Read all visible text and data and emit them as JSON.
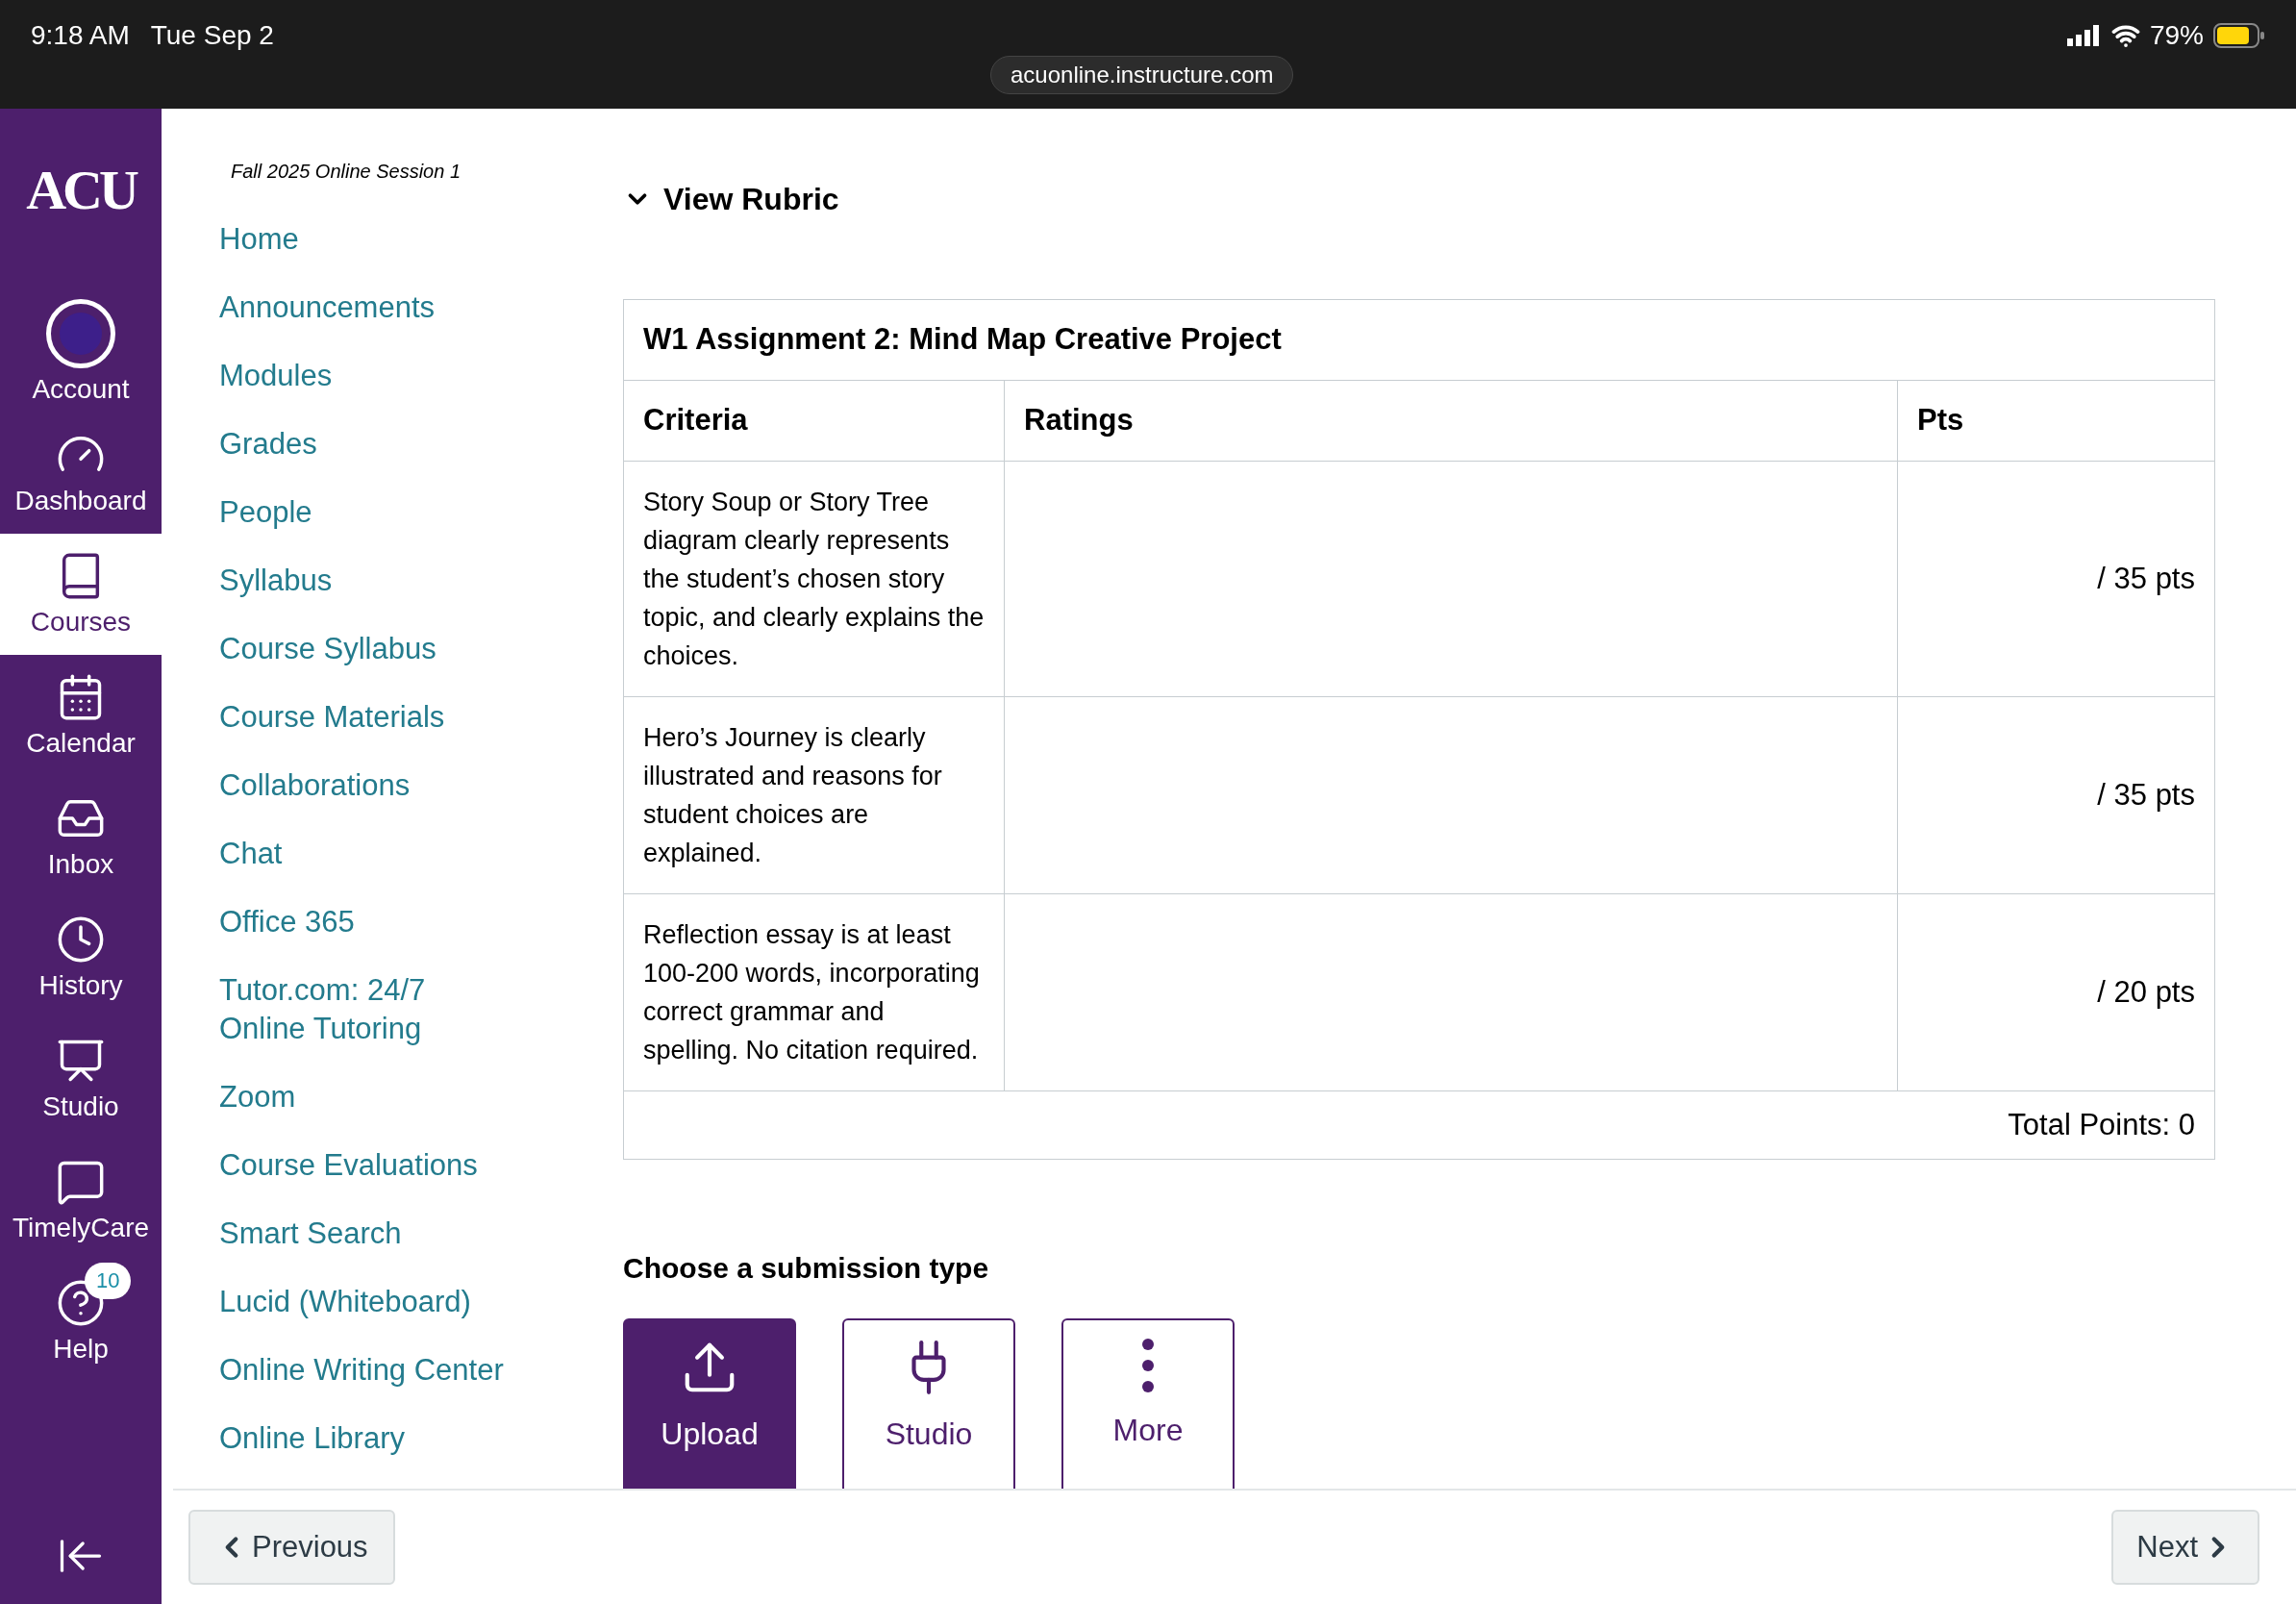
{
  "status_bar": {
    "time": "9:18 AM",
    "date": "Tue Sep 2",
    "url": "acuonline.instructure.com",
    "battery": "79%"
  },
  "global_nav": {
    "logo": "ACU",
    "items": [
      {
        "label": "Account",
        "kind": "account",
        "selected": false
      },
      {
        "label": "Dashboard",
        "kind": "dashboard",
        "selected": false
      },
      {
        "label": "Courses",
        "kind": "courses",
        "selected": true
      },
      {
        "label": "Calendar",
        "kind": "calendar",
        "selected": false
      },
      {
        "label": "Inbox",
        "kind": "inbox",
        "selected": false
      },
      {
        "label": "History",
        "kind": "history",
        "selected": false
      },
      {
        "label": "Studio",
        "kind": "studio",
        "selected": false
      },
      {
        "label": "TimelyCare",
        "kind": "timelycare",
        "selected": false
      },
      {
        "label": "Help",
        "kind": "help",
        "selected": false,
        "badge": "10"
      }
    ]
  },
  "course_nav": {
    "term": "Fall 2025 Online Session 1",
    "items": [
      [
        "Home"
      ],
      [
        "Announcements"
      ],
      [
        "Modules"
      ],
      [
        "Grades"
      ],
      [
        "People"
      ],
      [
        "Syllabus"
      ],
      [
        "Course Syllabus"
      ],
      [
        "Course Materials"
      ],
      [
        "Collaborations"
      ],
      [
        "Chat"
      ],
      [
        "Office 365"
      ],
      [
        "Tutor.com: 24/7",
        "Online Tutoring"
      ],
      [
        "Zoom"
      ],
      [
        "Course Evaluations"
      ],
      [
        "Smart Search"
      ],
      [
        "Lucid (Whiteboard)"
      ],
      [
        "Online Writing Center"
      ],
      [
        "Online Library"
      ]
    ]
  },
  "rubric": {
    "toggle": "View Rubric",
    "expanded": true,
    "title": "W1 Assignment 2: Mind Map Creative Project",
    "columns": [
      "Criteria",
      "Ratings",
      "Pts"
    ],
    "rows": [
      {
        "criteria": "Story Soup or Story Tree diagram clearly represents the student’s chosen story topic, and clearly explains the choices.",
        "pts": "/ 35 pts"
      },
      {
        "criteria": "Hero’s Journey is clearly illustrated and reasons for student choices are explained.",
        "pts": "/ 35 pts"
      },
      {
        "criteria": "Reflection essay is at least 100-200 words, incorporating correct grammar and spelling. No citation required.",
        "pts": "/ 20 pts"
      }
    ],
    "total": "Total Points: 0"
  },
  "submission": {
    "heading": "Choose a submission type",
    "types": [
      {
        "label": "Upload",
        "kind": "upload",
        "selected": true
      },
      {
        "label": "Studio",
        "kind": "plugin",
        "selected": false
      },
      {
        "label": "More",
        "kind": "more",
        "selected": false
      }
    ]
  },
  "footer": {
    "previous": "Previous",
    "next": "Next"
  }
}
